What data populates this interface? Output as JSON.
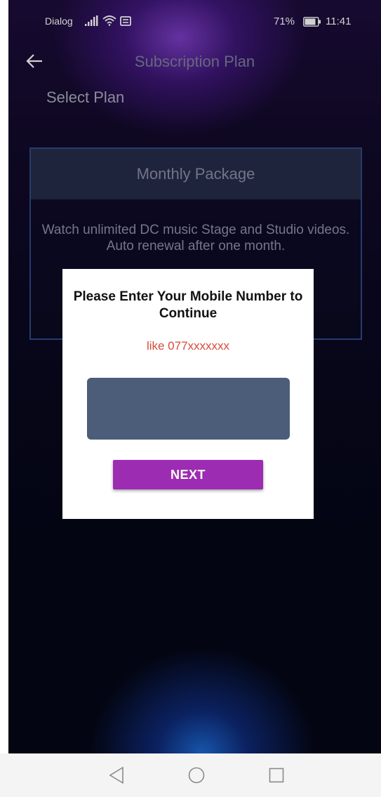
{
  "status_bar": {
    "carrier": "Dialog",
    "battery_percent": "71%",
    "time": "11:41",
    "icons": [
      "signal-icon",
      "wifi-icon",
      "sim-icon",
      "battery-icon"
    ]
  },
  "header": {
    "back_icon": "arrow-left-icon",
    "title": "Subscription Plan"
  },
  "main": {
    "section_title": "Select Plan",
    "plan": {
      "name": "Monthly Package",
      "description": "Watch unlimited DC music Stage and Studio videos. Auto renewal after one month."
    }
  },
  "dialog": {
    "title": "Please Enter Your Mobile Number to Continue",
    "hint": "like 077xxxxxxx",
    "input_value": "",
    "input_placeholder": "",
    "next_label": "NEXT"
  },
  "nav_bar": {
    "icons": [
      "nav-back-icon",
      "nav-home-icon",
      "nav-recent-icon"
    ]
  },
  "colors": {
    "dialog_button": "#9c2cb1",
    "input_background": "#4b5d78",
    "hint_text": "#d94a3a",
    "card_border": "#2f4a86",
    "card_header": "#252c48"
  }
}
